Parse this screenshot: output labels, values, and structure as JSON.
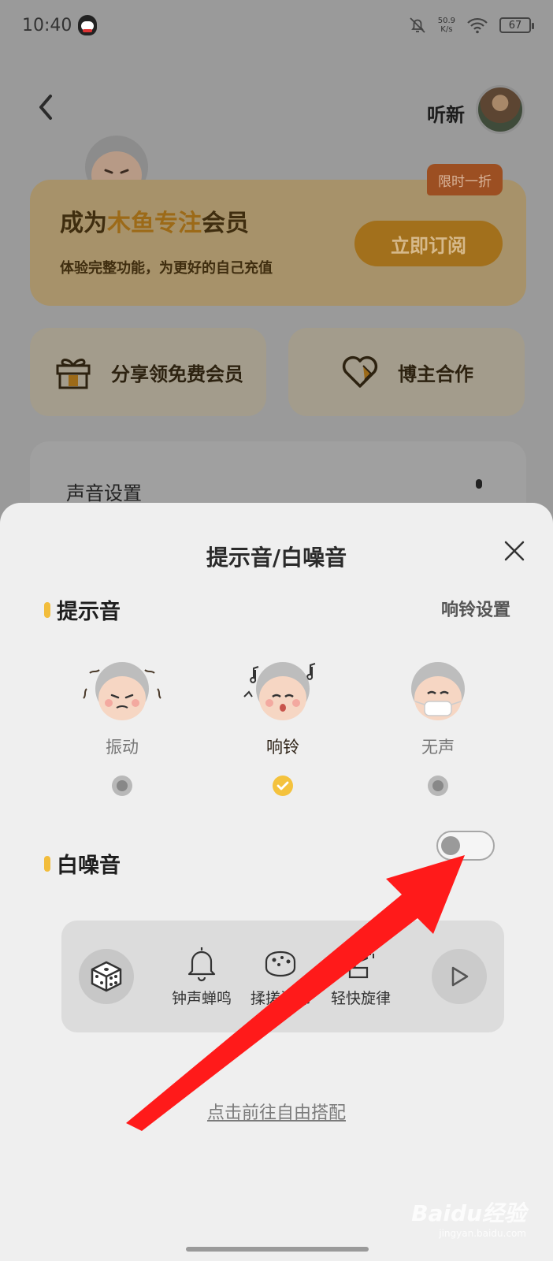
{
  "status_bar": {
    "time": "10:40",
    "net_speed_value": "50.9",
    "net_speed_unit": "K/s",
    "battery": "67"
  },
  "nav": {
    "username": "听新"
  },
  "member_card": {
    "title_prefix": "成为",
    "title_highlight": "木鱼专注",
    "title_suffix": "会员",
    "description": "体验完整功能，为更好的自己充值",
    "subscribe_label": "立即订阅",
    "discount_tag": "限时一折"
  },
  "features": {
    "share_label": "分享领免费会员",
    "coop_label": "博主合作"
  },
  "settings": {
    "sound_settings_label": "声音设置"
  },
  "sheet": {
    "title": "提示音/白噪音",
    "tone_section": "提示音",
    "ring_settings_link": "响铃设置",
    "modes": [
      {
        "label": "振动",
        "selected": false
      },
      {
        "label": "响铃",
        "selected": true
      },
      {
        "label": "无声",
        "selected": false
      }
    ],
    "noise_section": "白噪音",
    "noise_enabled": false,
    "sounds": [
      {
        "label": "钟声蝉鸣",
        "icon": "bell-icon"
      },
      {
        "label": "揉搓海绵",
        "icon": "sponge-icon"
      },
      {
        "label": "轻快旋律",
        "icon": "gramophone-icon"
      }
    ],
    "free_mix_link": "点击前往自由搭配"
  },
  "watermark": {
    "brand": "Baidu经验",
    "url": "jingyan.baidu.com"
  },
  "colors": {
    "accent_yellow": "#f4c23d",
    "annotation_red": "#ff1a1a",
    "sheet_bg": "#efefef"
  }
}
